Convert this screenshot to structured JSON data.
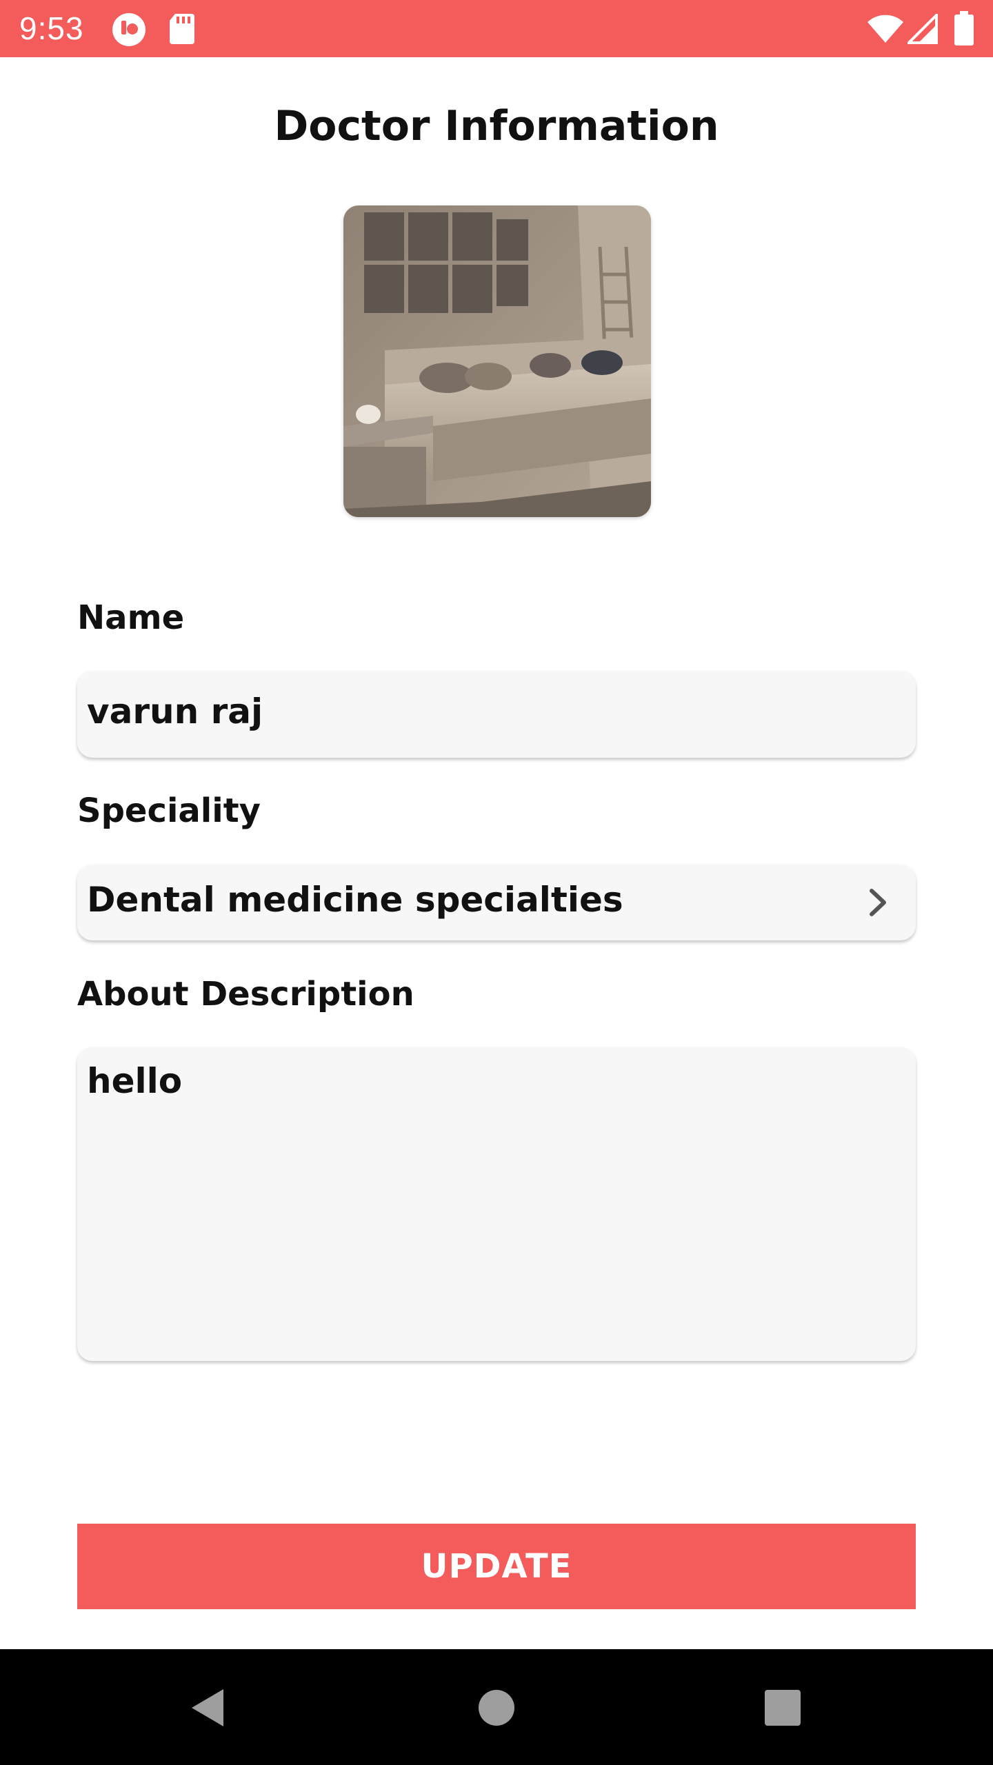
{
  "status_bar": {
    "time": "9:53",
    "left_icons": [
      "app-notification-icon",
      "sd-card-icon"
    ],
    "right_icons": [
      "wifi-icon",
      "cellular-signal-icon",
      "battery-icon"
    ],
    "background_color": "#f45b5b"
  },
  "page": {
    "title": "Doctor Information"
  },
  "profile_photo": {
    "icon": "profile-photo"
  },
  "form": {
    "name": {
      "label": "Name",
      "value": "varun raj"
    },
    "speciality": {
      "label": "Speciality",
      "value": "Dental medicine specialties",
      "icon": "chevron-right-icon"
    },
    "about": {
      "label": "About Description",
      "value": "hello"
    }
  },
  "update_button": {
    "label": "UPDATE",
    "color": "#f45b5b"
  },
  "nav_bar": {
    "icons": [
      "back-icon",
      "home-icon",
      "recents-icon"
    ]
  }
}
